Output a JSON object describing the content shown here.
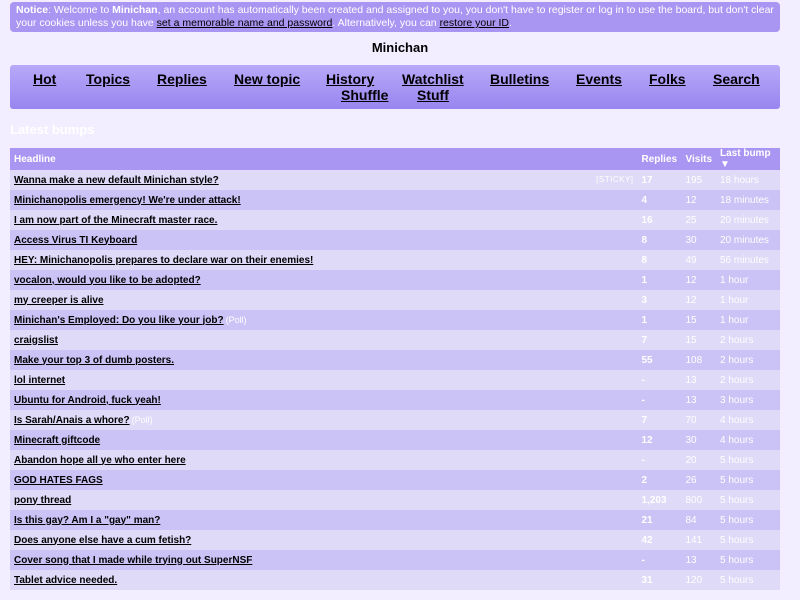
{
  "notice": {
    "label": "Notice",
    "text1": ": Welcome to ",
    "site": "Minichan",
    "text2": ", an account has automatically been created and assigned to you, you don't have to register or log in to use the board, but don't clear your cookies unless you have ",
    "link1": "set a memorable name and password",
    "text3": ". Alternatively, you can ",
    "link2": "restore your ID",
    "text4": "."
  },
  "site_title": "Minichan",
  "nav": {
    "hot": "Hot",
    "topics": "Topics",
    "replies": "Replies",
    "new_topic": "New topic",
    "history": "History",
    "watchlist": "Watchlist",
    "bulletins": "Bulletins",
    "events": "Events",
    "folks": "Folks",
    "search": "Search",
    "shuffle": "Shuffle",
    "stuff": "Stuff"
  },
  "section_title": "Latest bumps",
  "table": {
    "headers": {
      "headline": "Headline",
      "replies": "Replies",
      "visits": "Visits",
      "last_bump": "Last bump ▼"
    },
    "rows": [
      {
        "headline": "Wanna make a new default Minichan style?",
        "tag": "",
        "sticky": "[STICKY]",
        "replies": "17",
        "visits": "195",
        "last_bump": "18 hours"
      },
      {
        "headline": "Minichanopolis emergency! We're under attack!",
        "tag": "",
        "sticky": "",
        "replies": "4",
        "visits": "12",
        "last_bump": "18 minutes"
      },
      {
        "headline": "I am now part of the Minecraft master race.",
        "tag": "",
        "sticky": "",
        "replies": "16",
        "visits": "25",
        "last_bump": "20 minutes"
      },
      {
        "headline": "Access Virus TI Keyboard",
        "tag": "",
        "sticky": "",
        "replies": "8",
        "visits": "30",
        "last_bump": "20 minutes"
      },
      {
        "headline": "HEY: Minichanopolis prepares to declare war on their enemies!",
        "tag": "",
        "sticky": "",
        "replies": "8",
        "visits": "49",
        "last_bump": "56 minutes"
      },
      {
        "headline": "vocalon, would you like to be adopted?",
        "tag": "",
        "sticky": "",
        "replies": "1",
        "visits": "12",
        "last_bump": "1 hour"
      },
      {
        "headline": "my creeper is alive",
        "tag": "",
        "sticky": "",
        "replies": "3",
        "visits": "12",
        "last_bump": "1 hour"
      },
      {
        "headline": "Minichan's Employed: Do you like your job?",
        "tag": "(Poll)",
        "sticky": "",
        "replies": "1",
        "visits": "15",
        "last_bump": "1 hour"
      },
      {
        "headline": "craigslist",
        "tag": "",
        "sticky": "",
        "replies": "7",
        "visits": "15",
        "last_bump": "2 hours"
      },
      {
        "headline": "Make your top 3 of dumb posters.",
        "tag": "",
        "sticky": "",
        "replies": "55",
        "visits": "108",
        "last_bump": "2 hours"
      },
      {
        "headline": "lol internet",
        "tag": "",
        "sticky": "",
        "replies": "-",
        "visits": "13",
        "last_bump": "2 hours"
      },
      {
        "headline": "Ubuntu for Android, fuck yeah!",
        "tag": "",
        "sticky": "",
        "replies": "-",
        "visits": "13",
        "last_bump": "3 hours"
      },
      {
        "headline": "Is Sarah/Anais a whore?",
        "tag": "(Poll)",
        "sticky": "",
        "replies": "7",
        "visits": "70",
        "last_bump": "4 hours"
      },
      {
        "headline": "Minecraft giftcode",
        "tag": "",
        "sticky": "",
        "replies": "12",
        "visits": "30",
        "last_bump": "4 hours"
      },
      {
        "headline": "Abandon hope all ye who enter here",
        "tag": "",
        "sticky": "",
        "replies": "-",
        "visits": "20",
        "last_bump": "5 hours"
      },
      {
        "headline": "GOD HATES FAGS",
        "tag": "",
        "sticky": "",
        "replies": "2",
        "visits": "26",
        "last_bump": "5 hours"
      },
      {
        "headline": "pony thread",
        "tag": "",
        "sticky": "",
        "replies": "1,203",
        "visits": "800",
        "last_bump": "5 hours"
      },
      {
        "headline": "Is this gay? Am I a \"gay\" man?",
        "tag": "",
        "sticky": "",
        "replies": "21",
        "visits": "84",
        "last_bump": "5 hours"
      },
      {
        "headline": "Does anyone else have a cum fetish?",
        "tag": "",
        "sticky": "",
        "replies": "42",
        "visits": "141",
        "last_bump": "5 hours"
      },
      {
        "headline": "Cover song that I made while trying out SuperNSF",
        "tag": "",
        "sticky": "",
        "replies": "-",
        "visits": "13",
        "last_bump": "5 hours"
      },
      {
        "headline": "Tablet advice needed.",
        "tag": "",
        "sticky": "",
        "replies": "31",
        "visits": "120",
        "last_bump": "5 hours"
      }
    ]
  }
}
